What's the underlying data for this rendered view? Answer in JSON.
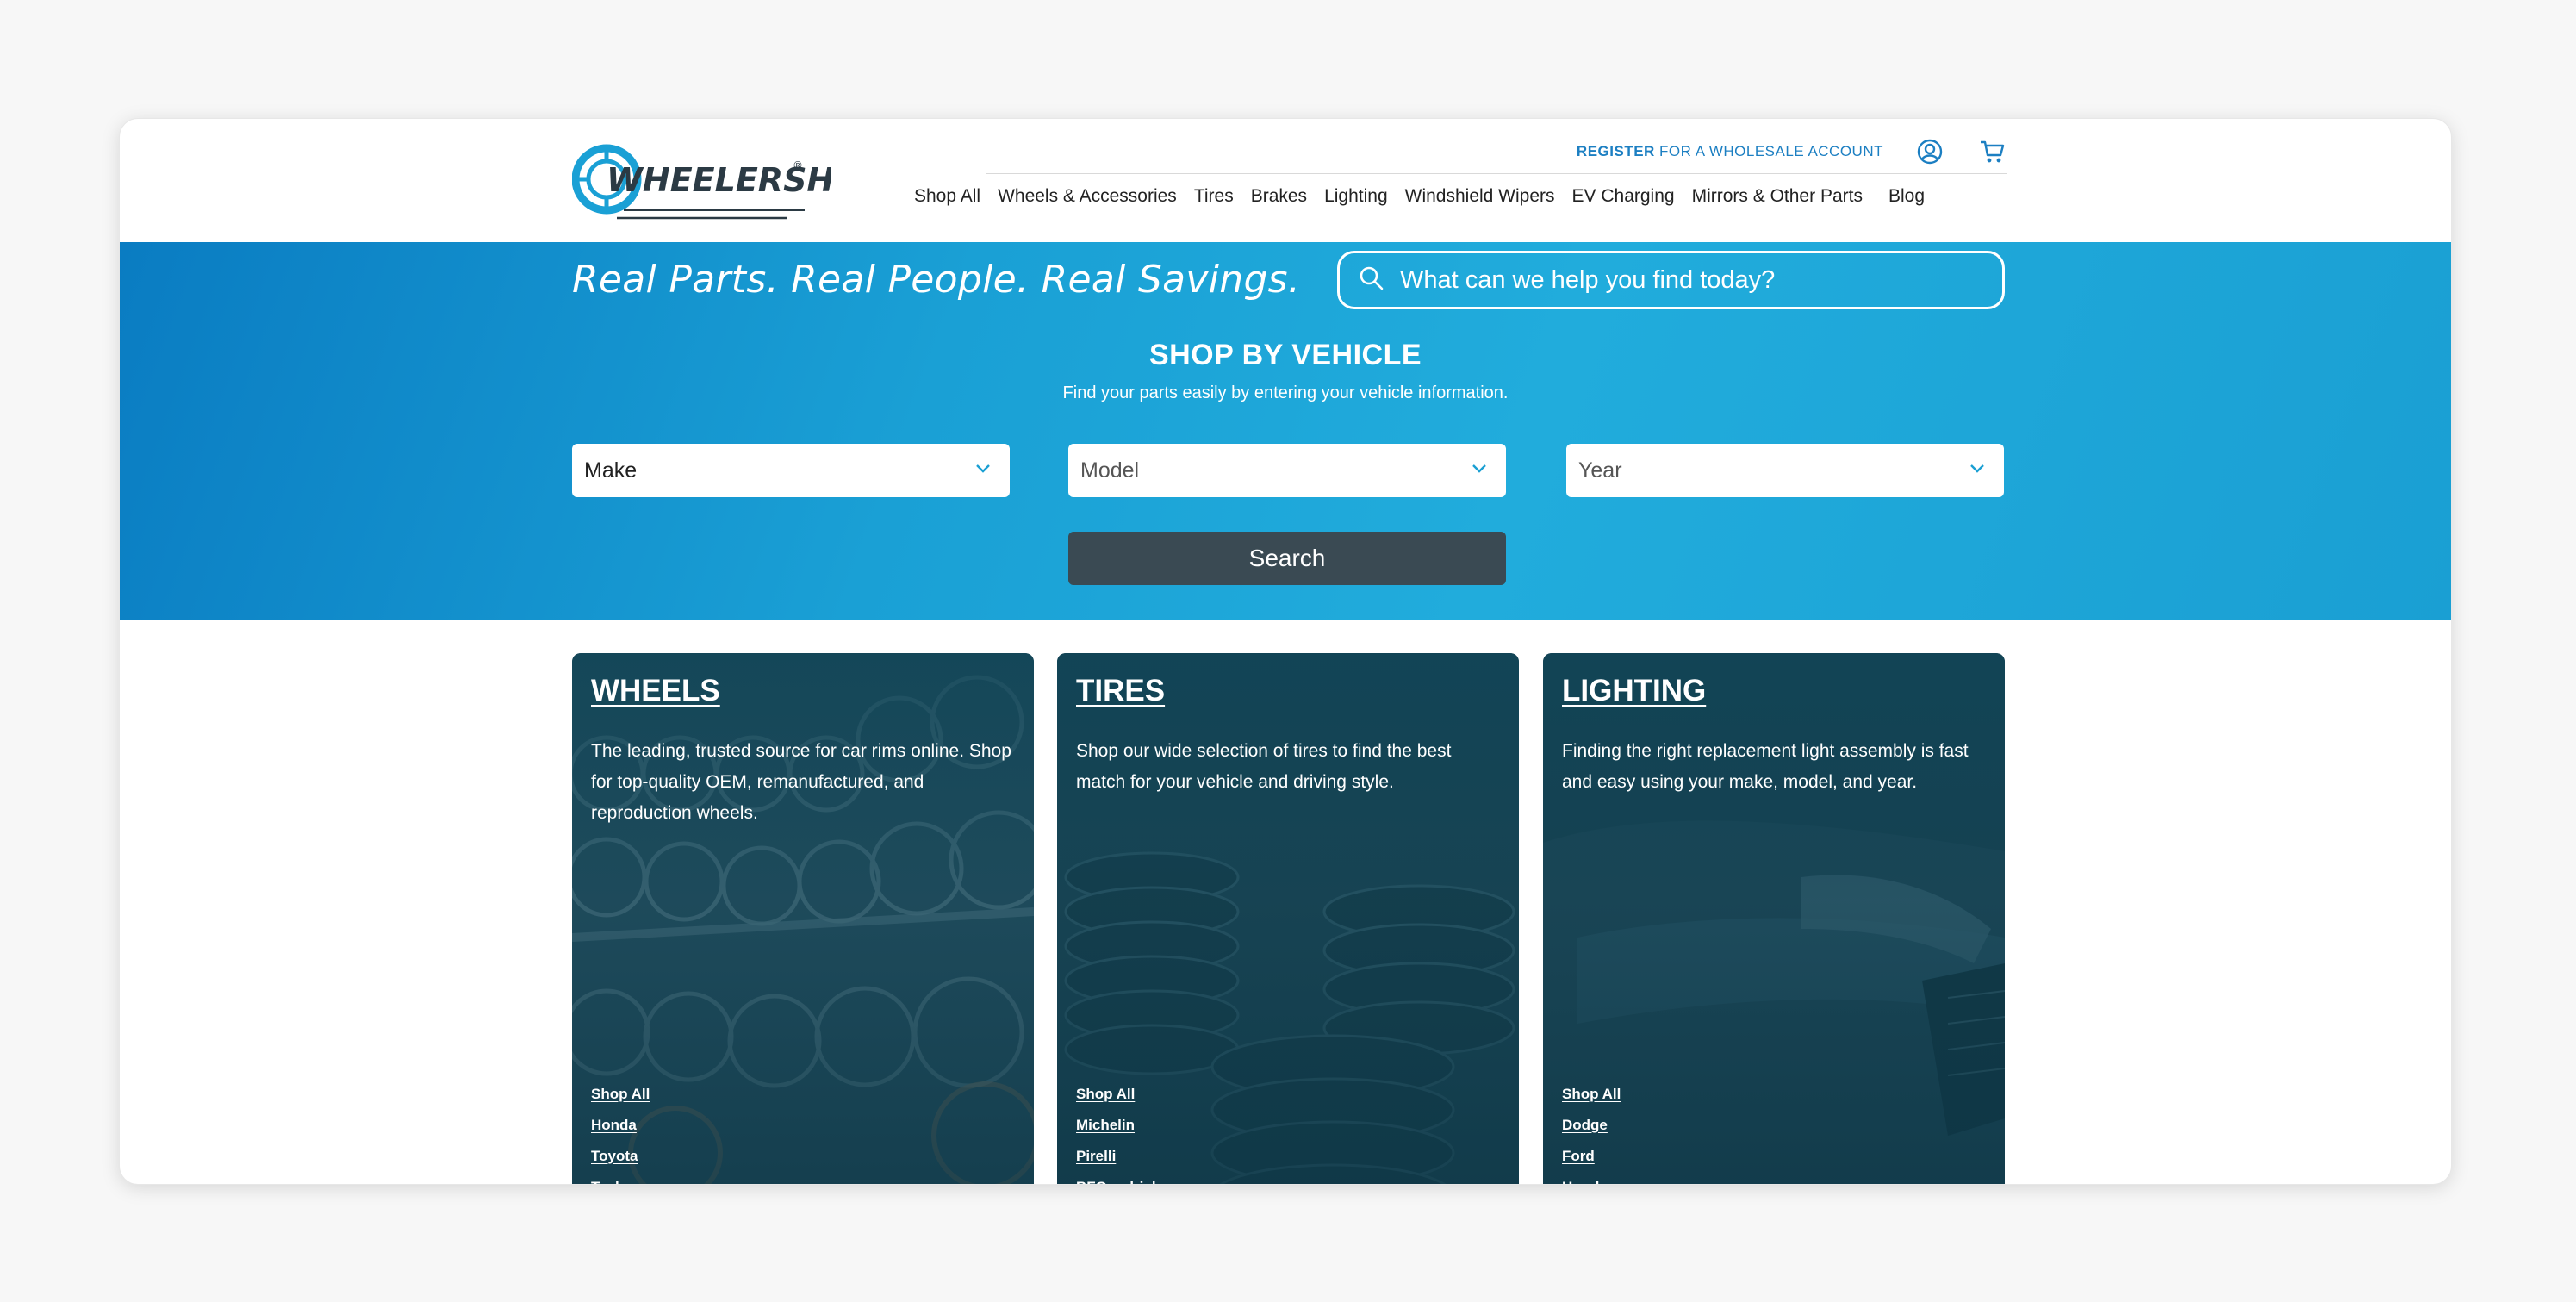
{
  "header": {
    "logo_text": "WHEELERSHIP",
    "register_bold": "REGISTER",
    "register_rest": " FOR A WHOLESALE ACCOUNT",
    "nav": [
      "Shop All",
      "Wheels & Accessories",
      "Tires",
      "Brakes",
      "Lighting",
      "Windshield Wipers",
      "EV Charging",
      "Mirrors & Other Parts",
      "Blog"
    ]
  },
  "hero": {
    "tagline": "Real Parts. Real People. Real Savings.",
    "search_placeholder": "What can we help you find today?",
    "title": "SHOP BY VEHICLE",
    "subtitle": "Find your parts easily by entering your vehicle information.",
    "make": "Make",
    "model": "Model",
    "year": "Year",
    "search_button": "Search"
  },
  "cards": [
    {
      "title": "WHEELS",
      "description": "The leading, trusted source for car rims online. Shop for top-quality OEM, remanufactured, and reproduction wheels.",
      "links": [
        "Shop All",
        "Honda",
        "Toyota",
        "Tesla"
      ]
    },
    {
      "title": "TIRES",
      "description": "Shop our wide selection of tires to find the best match for your vehicle and driving style.",
      "links": [
        "Shop All",
        "Michelin",
        "Pirelli",
        "BFGoodrich"
      ]
    },
    {
      "title": "LIGHTING",
      "description": "Finding the right replacement light assembly is fast and easy using your make, model, and year.",
      "links": [
        "Shop All",
        "Dodge",
        "Ford",
        "Honda"
      ]
    }
  ],
  "colors": {
    "brand_blue": "#1a9fd3",
    "link_blue": "#1c7fc2",
    "button_dark": "#3a4a53"
  },
  "icons": {
    "account": "user-circle-icon",
    "cart": "cart-icon",
    "search": "search-icon",
    "dropdown": "chevron-down-icon"
  }
}
